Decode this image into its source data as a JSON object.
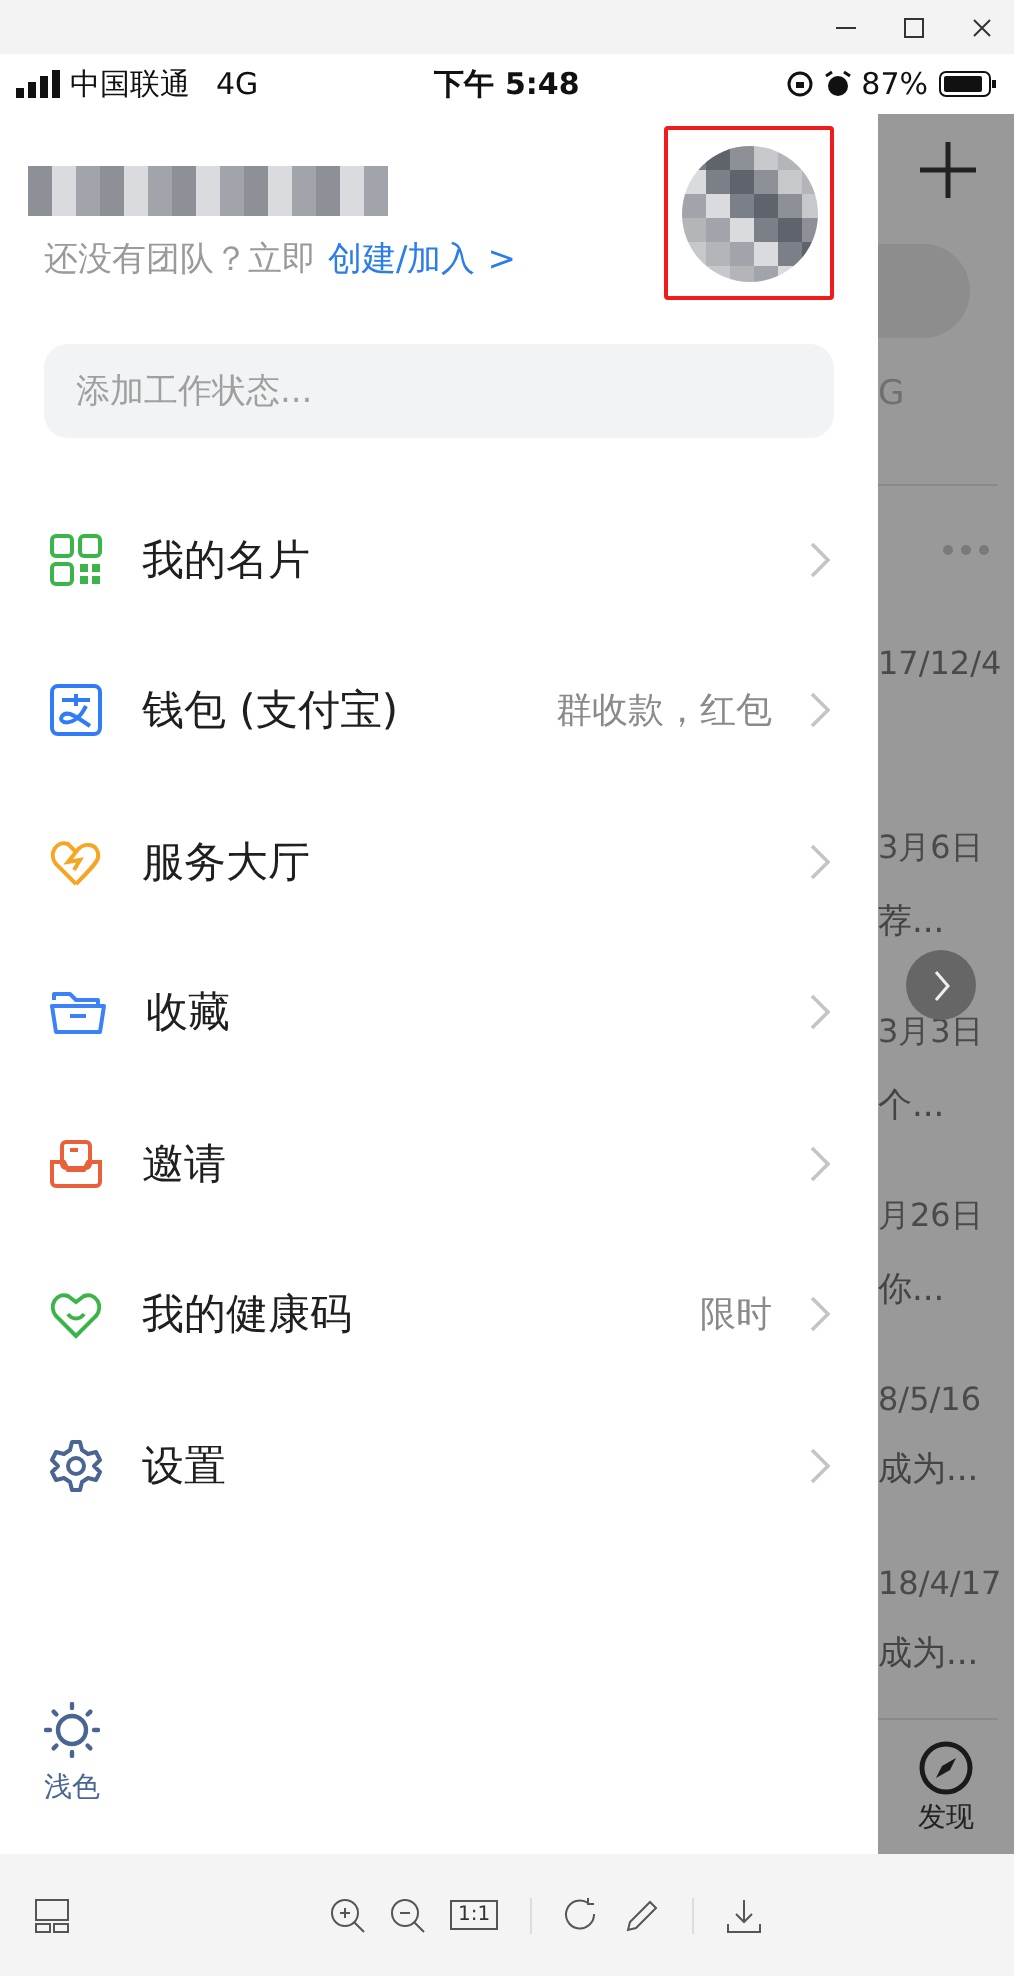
{
  "status_bar": {
    "carrier": "中国联通",
    "network": "4G",
    "time": "下午 5:48",
    "battery": "87%"
  },
  "drawer": {
    "team_prompt": "还没有团队？立即",
    "team_link": "创建/加入",
    "team_link_arrow": ">",
    "status_field": {
      "placeholder": "添加工作状态..."
    },
    "items": [
      {
        "label": "我的名片"
      },
      {
        "label": "钱包 (支付宝)",
        "note": "群收款，红包"
      },
      {
        "label": "服务大厅"
      },
      {
        "label": "收藏"
      },
      {
        "label": "邀请"
      },
      {
        "label": "我的健康码",
        "note": "限时"
      },
      {
        "label": "设置"
      }
    ],
    "theme_toggle": {
      "label": "浅色"
    }
  },
  "background_app": {
    "header_text": "G",
    "rows": [
      {
        "date": "17/12/4"
      },
      {
        "date": "3月6日",
        "preview": "荐..."
      },
      {
        "date": "3月3日",
        "preview": "个..."
      },
      {
        "date": "月26日",
        "preview": "你..."
      },
      {
        "date": "8/5/16",
        "preview": "成为..."
      },
      {
        "date": "18/4/17",
        "preview": "成为..."
      }
    ],
    "tab": {
      "label": "发现"
    }
  },
  "viewer_toolbar": {
    "actual_size": "1:1"
  }
}
